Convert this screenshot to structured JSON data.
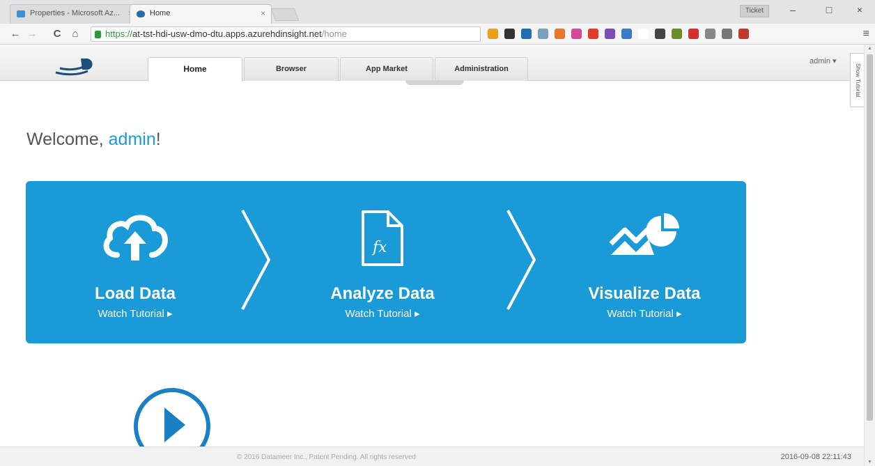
{
  "browser": {
    "tabs": [
      {
        "title": "Properties - Microsoft Az..."
      },
      {
        "title": "Home"
      }
    ],
    "profile_label": "Ticket",
    "url": {
      "scheme": "https://",
      "host": "at-tst-hdi-usw-dmo-dtu.apps.azurehdinsight.net",
      "path": "/home"
    },
    "extension_icon_colors": [
      "#e9a11a",
      "#333333",
      "#1f6fb5",
      "#7aa0c0",
      "#e8762b",
      "#d04a98",
      "#e33b2e",
      "#7d4fb3",
      "#3a7ac7",
      "#ffffff",
      "#444444",
      "#6a8c2a",
      "#d33030",
      "#888888",
      "#777777",
      "#c0392b"
    ],
    "controls": {
      "back": "←",
      "forward": "→",
      "reload": "C",
      "home": "⌂",
      "minimize": "–",
      "maximize": "□",
      "close": "×",
      "menu": "≡",
      "tab_close": "×"
    }
  },
  "app": {
    "nav_tabs": [
      {
        "label": "Home",
        "active": true
      },
      {
        "label": "Browser",
        "active": false
      },
      {
        "label": "App Market",
        "active": false
      },
      {
        "label": "Administration",
        "active": false
      }
    ],
    "user_menu": "admin ▾",
    "show_tutorial": "Show Tutorial",
    "welcome": {
      "prefix": "Welcome, ",
      "username": "admin",
      "suffix": "!"
    },
    "workflow": {
      "accent_color": "#1a9ad6",
      "steps": [
        {
          "title": "Load Data",
          "link": "Watch Tutorial ▸",
          "icon": "cloud-upload-icon"
        },
        {
          "title": "Analyze Data",
          "link": "Watch Tutorial ▸",
          "icon": "document-fx-icon"
        },
        {
          "title": "Visualize Data",
          "link": "Watch Tutorial ▸",
          "icon": "chart-pie-icon"
        }
      ]
    },
    "footer": {
      "copyright": "© 2016 Datameer Inc., Patent Pending. All rights reserved",
      "timestamp": "2016-09-08 22:11:43"
    }
  }
}
